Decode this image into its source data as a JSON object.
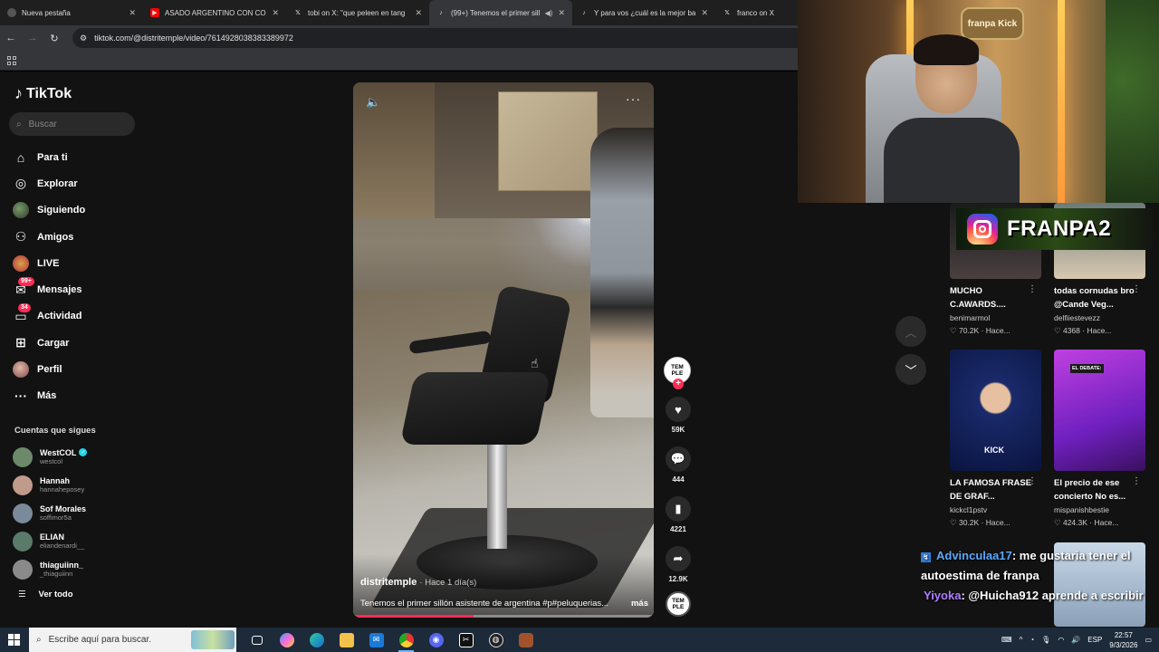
{
  "browser": {
    "tabs": [
      {
        "title": "Nueva pestaña",
        "icon": "chrome-icon",
        "fav_color": "#444",
        "active": false
      },
      {
        "title": "ASADO ARGENTINO CON COS",
        "icon": "youtube-icon",
        "fav_color": "#ff0000",
        "active": false
      },
      {
        "title": "tobi on X: \"que peleen en tang",
        "icon": "x-icon",
        "fav_color": "#000000",
        "active": false
      },
      {
        "title": "(99+) Tenemos el primer sillón",
        "icon": "tiktok-icon",
        "fav_color": "#000000",
        "active": true
      },
      {
        "title": "Y para vos ¿cuál es la mejor bar",
        "icon": "tiktok-icon",
        "fav_color": "#000000",
        "active": false
      },
      {
        "title": "franco on X",
        "icon": "x-icon",
        "fav_color": "#000000",
        "active": false
      }
    ],
    "url": "tiktok.com/@distritemple/video/7614928038383389972"
  },
  "tiktok": {
    "logo_text": "TikTok",
    "search_placeholder": "Buscar",
    "menu": [
      {
        "label": "Para ti",
        "icon": "home-icon",
        "glyph": "⌂"
      },
      {
        "label": "Explorar",
        "icon": "compass-icon",
        "glyph": "◎"
      },
      {
        "label": "Siguiendo",
        "icon": "following-avatar-icon",
        "glyph": ""
      },
      {
        "label": "Amigos",
        "icon": "friends-icon",
        "glyph": "⚇"
      },
      {
        "label": "LIVE",
        "icon": "live-icon",
        "glyph": ""
      },
      {
        "label": "Mensajes",
        "icon": "messages-icon",
        "glyph": "✉",
        "badge": "99+"
      },
      {
        "label": "Actividad",
        "icon": "activity-icon",
        "glyph": "▭",
        "badge": "34"
      },
      {
        "label": "Cargar",
        "icon": "upload-icon",
        "glyph": "⊞"
      },
      {
        "label": "Perfil",
        "icon": "profile-avatar-icon",
        "glyph": ""
      },
      {
        "label": "Más",
        "icon": "more-icon",
        "glyph": "···"
      }
    ],
    "following_title": "Cuentas que sigues",
    "following": [
      {
        "name": "WestCOL",
        "user": "westcol",
        "verified": true,
        "color": "#6c8a6a"
      },
      {
        "name": "Hannah",
        "user": "hannahеposey",
        "verified": false,
        "color": "#c09a8a"
      },
      {
        "name": "Sof Morales",
        "user": "soffimor5a",
        "verified": false,
        "color": "#7a8a9a"
      },
      {
        "name": "ELIAN",
        "user": "eliandenardi__",
        "verified": false,
        "color": "#5a7a6a"
      },
      {
        "name": "thiaguiinn_",
        "user": "_thiaguiinn",
        "verified": false,
        "color": "#8a8a8a"
      }
    ],
    "see_all": "Ver todo",
    "video": {
      "author": "distritemple",
      "when": "· Hace 1 día(s)",
      "description": "Tenemos el primer sillón  asistente de argentina #p#peluquerias...",
      "more": "más",
      "progress": 0.4
    },
    "actions": {
      "avatar_text": "TEM PLE",
      "likes": "59K",
      "comments": "444",
      "saves": "4221",
      "shares": "12.9K"
    },
    "recommended": [
      {
        "title": "MUCHO C.AWARDS....",
        "user": "benimarmol",
        "views": "♡ 70.2K",
        "when": "· Hace...",
        "thumb": "#3a3a3a"
      },
      {
        "title": "todas cornudas bro @Cande Veg...",
        "user": "delfiiestevezz",
        "views": "♡ 4368",
        "when": "· Hace...",
        "thumb": "#b8a890"
      },
      {
        "title": "LA FAMOSA FRASE DE GRAF...",
        "user": "kickcl1pstv",
        "views": "♡ 30.2K",
        "when": "· Hace...",
        "thumb": "#1a3a8a",
        "overlay": "KICK"
      },
      {
        "title": "El precio de ese concierto No es...",
        "user": "mispanishbestie",
        "views": "♡ 424.3K",
        "when": "· Hace...",
        "thumb": "#8a2ad0",
        "overlay": "EL DEBATE:"
      }
    ]
  },
  "overlay": {
    "instagram_handle": "FRANPA2",
    "webcam_sign": "franpa Kick",
    "chat": [
      {
        "user": "Advinculaa17",
        "text": ": me gustaria tener el autoestima de franpa"
      },
      {
        "user": "Yiyoka",
        "text": ": @Huicha912 aprende a escribir"
      }
    ]
  },
  "taskbar": {
    "search_placeholder": "Escribe aquí para buscar.",
    "lang": "ESP",
    "time": "22:57",
    "date": "9/3/2026"
  }
}
